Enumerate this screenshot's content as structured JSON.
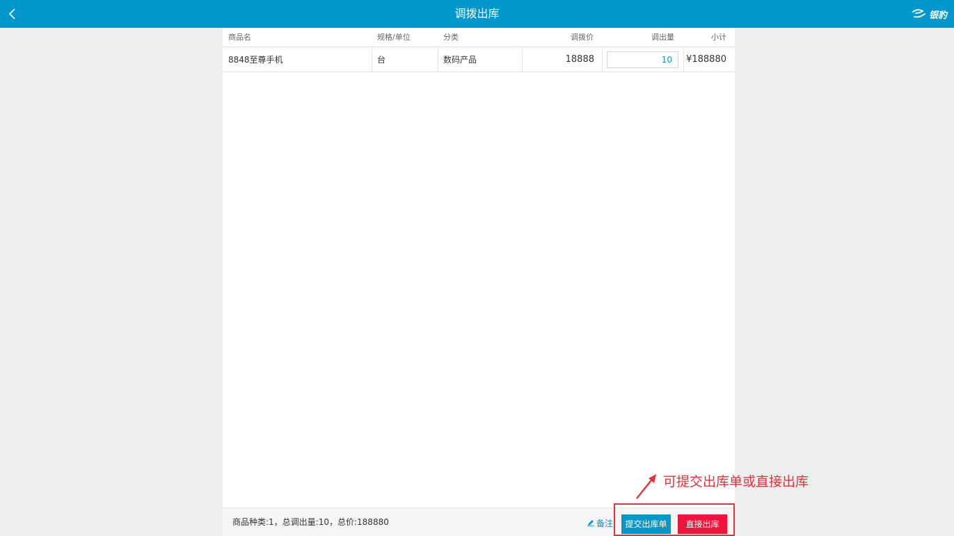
{
  "header": {
    "title": "调拨出库",
    "logo_text": "银豹",
    "bg_color": "#0497cd"
  },
  "table": {
    "columns": [
      "商品名",
      "规格/单位",
      "分类",
      "调拨价",
      "调出量",
      "小计"
    ],
    "rows": [
      [
        "8848至尊手机",
        "台",
        "数码产品",
        "18888",
        "10",
        "¥188880"
      ]
    ]
  },
  "footer": {
    "summary": "商品种类:1，总调出量:10，总价:188880",
    "note_label": "备注",
    "submit_label": "提交出库单",
    "direct_label": "直接出库",
    "submit_color": "#0497cd",
    "direct_color": "#f0143c"
  },
  "annotation": {
    "text": "可提交出库单或直接出库",
    "color": "#e8303a"
  },
  "icons": {
    "back": "chevron-left-icon",
    "logo": "yinbao-logo-icon",
    "note": "pencil-icon"
  }
}
